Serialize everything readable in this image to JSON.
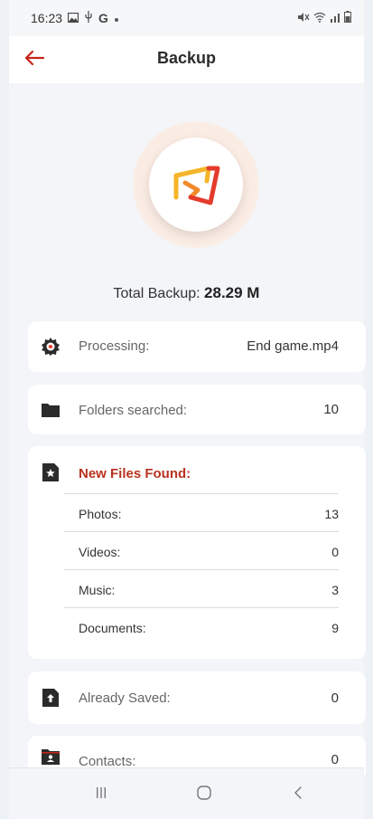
{
  "status_bar": {
    "time": "16:23",
    "icons": [
      "gallery-icon",
      "usb-icon",
      "google-icon",
      "dot-icon",
      "mute-icon",
      "wifi-icon",
      "signal-icon",
      "battery-icon"
    ]
  },
  "app_bar": {
    "title": "Backup",
    "back_icon": "arrow-left-icon"
  },
  "logo": {
    "icon": "backup-logo-icon",
    "colors": {
      "accent": "#e53b2c",
      "secondary": "#f5b52a"
    }
  },
  "total_backup": {
    "label": "Total Backup:",
    "value": "28.29 M"
  },
  "processing": {
    "label": "Processing:",
    "value": "End game.mp4",
    "icon": "gear-icon"
  },
  "folders_searched": {
    "label": "Folders searched:",
    "value": "10",
    "icon": "folder-icon"
  },
  "new_files": {
    "title": "New Files Found:",
    "icon": "star-file-icon",
    "title_color": "#b8321f",
    "rows": [
      {
        "label": "Photos:",
        "value": "13"
      },
      {
        "label": "Videos:",
        "value": "0"
      },
      {
        "label": "Music:",
        "value": "3"
      },
      {
        "label": "Documents:",
        "value": "9"
      }
    ]
  },
  "already_saved": {
    "label": "Already Saved:",
    "value": "0",
    "icon": "upload-file-icon"
  },
  "contacts": {
    "label": "Contacts:",
    "value": "0",
    "icon": "contacts-folder-icon"
  },
  "nav_bar": {
    "buttons": [
      "recents-icon",
      "home-icon",
      "back-icon"
    ]
  }
}
